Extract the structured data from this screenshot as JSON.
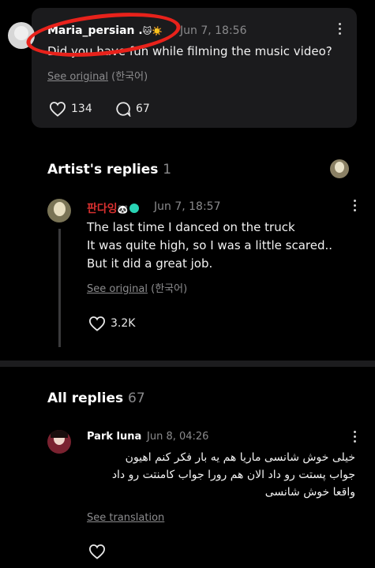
{
  "post": {
    "username": "Maria_persian",
    "username_suffix": ".",
    "username_emojis": "🐱☀️",
    "timestamp": "Jun 7, 18:56",
    "text": "Did you have fun while filming the music video?",
    "see_original_link": "See original",
    "see_original_lang": "(한국어)",
    "likes": "134",
    "comments": "67"
  },
  "artist_replies": {
    "title": "Artist's replies",
    "count": "1",
    "reply": {
      "username": "판다잉",
      "username_emoji": "🐼",
      "timestamp": "Jun 7, 18:57",
      "text": "The last time I danced on the truck\nIt was quite high, so I was a little scared..\nBut it did a great job.",
      "see_original_link": "See original",
      "see_original_lang": "(한국어)",
      "likes": "3.2K"
    }
  },
  "all_replies": {
    "title": "All replies",
    "count": "67",
    "reply": {
      "username": "Park luna",
      "timestamp": "Jun 8, 04:26",
      "text": "خیلی خوش شانسی ماریا هم یه بار فکر کنم اهیون\nجواب پستت رو داد الان هم رورا جواب کامنتت رو داد\nواقعا خوش شانسی",
      "see_translation_link": "See translation"
    }
  },
  "colors": {
    "background": "#000000",
    "card": "#1b1b1d",
    "muted_text": "#8a8a8c",
    "artist_name": "#d8302f",
    "annotation_red": "#e8221b"
  }
}
